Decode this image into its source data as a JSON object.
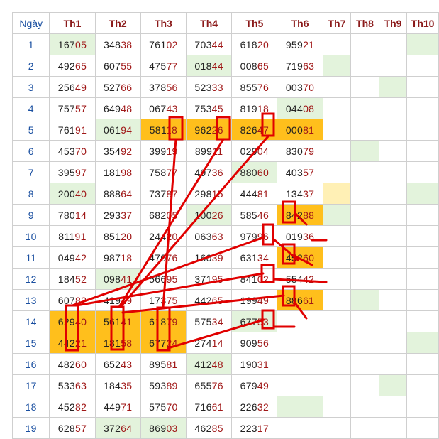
{
  "headers": [
    "Ngày",
    "Th1",
    "Th2",
    "Th3",
    "Th4",
    "Th5",
    "Th6",
    "Th7",
    "Th8",
    "Th9",
    "Th10"
  ],
  "rows": [
    {
      "day": "1",
      "cells": [
        {
          "head": "167",
          "tail": "05",
          "bg": "g"
        },
        {
          "head": "348",
          "tail": "38",
          "bg": ""
        },
        {
          "head": "761",
          "tail": "02",
          "bg": ""
        },
        {
          "head": "703",
          "tail": "44",
          "bg": ""
        },
        {
          "head": "618",
          "tail": "20",
          "bg": ""
        },
        {
          "head": "959",
          "tail": "21",
          "bg": ""
        },
        {
          "head": "",
          "tail": "",
          "bg": ""
        },
        {
          "head": "",
          "tail": "",
          "bg": ""
        },
        {
          "head": "",
          "tail": "",
          "bg": ""
        },
        {
          "head": "",
          "tail": "",
          "bg": "g"
        }
      ]
    },
    {
      "day": "2",
      "cells": [
        {
          "head": "492",
          "tail": "65",
          "bg": ""
        },
        {
          "head": "607",
          "tail": "55",
          "bg": ""
        },
        {
          "head": "475",
          "tail": "77",
          "bg": ""
        },
        {
          "head": "018",
          "tail": "44",
          "bg": "g"
        },
        {
          "head": "008",
          "tail": "65",
          "bg": ""
        },
        {
          "head": "719",
          "tail": "63",
          "bg": ""
        },
        {
          "head": "",
          "tail": "",
          "bg": "g"
        },
        {
          "head": "",
          "tail": "",
          "bg": ""
        },
        {
          "head": "",
          "tail": "",
          "bg": ""
        },
        {
          "head": "",
          "tail": "",
          "bg": ""
        }
      ]
    },
    {
      "day": "3",
      "cells": [
        {
          "head": "256",
          "tail": "49",
          "bg": ""
        },
        {
          "head": "527",
          "tail": "66",
          "bg": ""
        },
        {
          "head": "378",
          "tail": "56",
          "bg": ""
        },
        {
          "head": "523",
          "tail": "33",
          "bg": ""
        },
        {
          "head": "855",
          "tail": "76",
          "bg": ""
        },
        {
          "head": "003",
          "tail": "70",
          "bg": ""
        },
        {
          "head": "",
          "tail": "",
          "bg": ""
        },
        {
          "head": "",
          "tail": "",
          "bg": ""
        },
        {
          "head": "",
          "tail": "",
          "bg": "g"
        },
        {
          "head": "",
          "tail": "",
          "bg": ""
        }
      ]
    },
    {
      "day": "4",
      "cells": [
        {
          "head": "757",
          "tail": "57",
          "bg": ""
        },
        {
          "head": "649",
          "tail": "48",
          "bg": ""
        },
        {
          "head": "067",
          "tail": "43",
          "bg": ""
        },
        {
          "head": "753",
          "tail": "45",
          "bg": ""
        },
        {
          "head": "819",
          "tail": "18",
          "bg": ""
        },
        {
          "head": "044",
          "tail": "08",
          "bg": "g"
        },
        {
          "head": "",
          "tail": "",
          "bg": ""
        },
        {
          "head": "",
          "tail": "",
          "bg": ""
        },
        {
          "head": "",
          "tail": "",
          "bg": ""
        },
        {
          "head": "",
          "tail": "",
          "bg": ""
        }
      ]
    },
    {
      "day": "5",
      "cells": [
        {
          "head": "761",
          "tail": "91",
          "bg": ""
        },
        {
          "head": "061",
          "tail": "94",
          "bg": "g"
        },
        {
          "head": "581",
          "tail": "18",
          "bg": "o"
        },
        {
          "head": "962",
          "tail": "26",
          "bg": "o"
        },
        {
          "head": "826",
          "tail": "47",
          "bg": "o"
        },
        {
          "head": "000",
          "tail": "81",
          "bg": "o"
        },
        {
          "head": "",
          "tail": "",
          "bg": ""
        },
        {
          "head": "",
          "tail": "",
          "bg": ""
        },
        {
          "head": "",
          "tail": "",
          "bg": ""
        },
        {
          "head": "",
          "tail": "",
          "bg": ""
        }
      ]
    },
    {
      "day": "6",
      "cells": [
        {
          "head": "453",
          "tail": "70",
          "bg": ""
        },
        {
          "head": "354",
          "tail": "92",
          "bg": ""
        },
        {
          "head": "399",
          "tail": "19",
          "bg": ""
        },
        {
          "head": "899",
          "tail": "11",
          "bg": ""
        },
        {
          "head": "029",
          "tail": "04",
          "bg": ""
        },
        {
          "head": "830",
          "tail": "79",
          "bg": ""
        },
        {
          "head": "",
          "tail": "",
          "bg": ""
        },
        {
          "head": "",
          "tail": "",
          "bg": "g"
        },
        {
          "head": "",
          "tail": "",
          "bg": ""
        },
        {
          "head": "",
          "tail": "",
          "bg": ""
        }
      ]
    },
    {
      "day": "7",
      "cells": [
        {
          "head": "395",
          "tail": "97",
          "bg": ""
        },
        {
          "head": "181",
          "tail": "98",
          "bg": ""
        },
        {
          "head": "758",
          "tail": "77",
          "bg": ""
        },
        {
          "head": "497",
          "tail": "36",
          "bg": ""
        },
        {
          "head": "880",
          "tail": "60",
          "bg": "g"
        },
        {
          "head": "403",
          "tail": "57",
          "bg": ""
        },
        {
          "head": "",
          "tail": "",
          "bg": ""
        },
        {
          "head": "",
          "tail": "",
          "bg": ""
        },
        {
          "head": "",
          "tail": "",
          "bg": ""
        },
        {
          "head": "",
          "tail": "",
          "bg": ""
        }
      ]
    },
    {
      "day": "8",
      "cells": [
        {
          "head": "200",
          "tail": "40",
          "bg": "g"
        },
        {
          "head": "888",
          "tail": "64",
          "bg": ""
        },
        {
          "head": "737",
          "tail": "87",
          "bg": ""
        },
        {
          "head": "298",
          "tail": "15",
          "bg": ""
        },
        {
          "head": "444",
          "tail": "81",
          "bg": ""
        },
        {
          "head": "134",
          "tail": "37",
          "bg": ""
        },
        {
          "head": "",
          "tail": "",
          "bg": "y"
        },
        {
          "head": "",
          "tail": "",
          "bg": ""
        },
        {
          "head": "",
          "tail": "",
          "bg": ""
        },
        {
          "head": "",
          "tail": "",
          "bg": "g"
        }
      ]
    },
    {
      "day": "9",
      "cells": [
        {
          "head": "780",
          "tail": "14",
          "bg": ""
        },
        {
          "head": "293",
          "tail": "37",
          "bg": ""
        },
        {
          "head": "682",
          "tail": "05",
          "bg": ""
        },
        {
          "head": "100",
          "tail": "26",
          "bg": "g"
        },
        {
          "head": "585",
          "tail": "46",
          "bg": ""
        },
        {
          "head": "842",
          "tail": "88",
          "bg": "o"
        },
        {
          "head": "",
          "tail": "",
          "bg": "g"
        },
        {
          "head": "",
          "tail": "",
          "bg": ""
        },
        {
          "head": "",
          "tail": "",
          "bg": ""
        },
        {
          "head": "",
          "tail": "",
          "bg": ""
        }
      ]
    },
    {
      "day": "10",
      "cells": [
        {
          "head": "811",
          "tail": "91",
          "bg": ""
        },
        {
          "head": "851",
          "tail": "20",
          "bg": ""
        },
        {
          "head": "244",
          "tail": "20",
          "bg": ""
        },
        {
          "head": "063",
          "tail": "63",
          "bg": ""
        },
        {
          "head": "979",
          "tail": "96",
          "bg": ""
        },
        {
          "head": "019",
          "tail": "36",
          "bg": ""
        },
        {
          "head": "",
          "tail": "",
          "bg": ""
        },
        {
          "head": "",
          "tail": "",
          "bg": ""
        },
        {
          "head": "",
          "tail": "",
          "bg": ""
        },
        {
          "head": "",
          "tail": "",
          "bg": ""
        }
      ]
    },
    {
      "day": "11",
      "cells": [
        {
          "head": "049",
          "tail": "42",
          "bg": ""
        },
        {
          "head": "987",
          "tail": "18",
          "bg": ""
        },
        {
          "head": "470",
          "tail": "76",
          "bg": ""
        },
        {
          "head": "160",
          "tail": "39",
          "bg": ""
        },
        {
          "head": "631",
          "tail": "34",
          "bg": ""
        },
        {
          "head": "452",
          "tail": "60",
          "bg": "o"
        },
        {
          "head": "",
          "tail": "",
          "bg": ""
        },
        {
          "head": "",
          "tail": "",
          "bg": ""
        },
        {
          "head": "",
          "tail": "",
          "bg": ""
        },
        {
          "head": "",
          "tail": "",
          "bg": ""
        }
      ]
    },
    {
      "day": "12",
      "cells": [
        {
          "head": "184",
          "tail": "52",
          "bg": ""
        },
        {
          "head": "098",
          "tail": "41",
          "bg": "g"
        },
        {
          "head": "566",
          "tail": "95",
          "bg": ""
        },
        {
          "head": "371",
          "tail": "95",
          "bg": ""
        },
        {
          "head": "841",
          "tail": "02",
          "bg": ""
        },
        {
          "head": "554",
          "tail": "42",
          "bg": ""
        },
        {
          "head": "",
          "tail": "",
          "bg": ""
        },
        {
          "head": "",
          "tail": "",
          "bg": ""
        },
        {
          "head": "",
          "tail": "",
          "bg": ""
        },
        {
          "head": "",
          "tail": "",
          "bg": ""
        }
      ]
    },
    {
      "day": "13",
      "cells": [
        {
          "head": "607",
          "tail": "82",
          "bg": ""
        },
        {
          "head": "419",
          "tail": "19",
          "bg": ""
        },
        {
          "head": "173",
          "tail": "75",
          "bg": ""
        },
        {
          "head": "442",
          "tail": "65",
          "bg": ""
        },
        {
          "head": "199",
          "tail": "49",
          "bg": ""
        },
        {
          "head": "886",
          "tail": "61",
          "bg": "o"
        },
        {
          "head": "",
          "tail": "",
          "bg": ""
        },
        {
          "head": "",
          "tail": "",
          "bg": "g"
        },
        {
          "head": "",
          "tail": "",
          "bg": ""
        },
        {
          "head": "",
          "tail": "",
          "bg": ""
        }
      ]
    },
    {
      "day": "14",
      "cells": [
        {
          "head": "629",
          "tail": "40",
          "bg": "o"
        },
        {
          "head": "561",
          "tail": "41",
          "bg": "o"
        },
        {
          "head": "618",
          "tail": "79",
          "bg": "o"
        },
        {
          "head": "575",
          "tail": "34",
          "bg": ""
        },
        {
          "head": "677",
          "tail": "53",
          "bg": "g"
        },
        {
          "head": "",
          "tail": "",
          "bg": ""
        },
        {
          "head": "",
          "tail": "",
          "bg": ""
        },
        {
          "head": "",
          "tail": "",
          "bg": ""
        },
        {
          "head": "",
          "tail": "",
          "bg": ""
        },
        {
          "head": "",
          "tail": "",
          "bg": ""
        }
      ]
    },
    {
      "day": "15",
      "cells": [
        {
          "head": "442",
          "tail": "21",
          "bg": "o"
        },
        {
          "head": "181",
          "tail": "58",
          "bg": "o"
        },
        {
          "head": "677",
          "tail": "24",
          "bg": "o"
        },
        {
          "head": "274",
          "tail": "14",
          "bg": ""
        },
        {
          "head": "909",
          "tail": "56",
          "bg": ""
        },
        {
          "head": "",
          "tail": "",
          "bg": ""
        },
        {
          "head": "",
          "tail": "",
          "bg": ""
        },
        {
          "head": "",
          "tail": "",
          "bg": ""
        },
        {
          "head": "",
          "tail": "",
          "bg": ""
        },
        {
          "head": "",
          "tail": "",
          "bg": "g"
        }
      ]
    },
    {
      "day": "16",
      "cells": [
        {
          "head": "482",
          "tail": "60",
          "bg": ""
        },
        {
          "head": "652",
          "tail": "43",
          "bg": ""
        },
        {
          "head": "895",
          "tail": "81",
          "bg": ""
        },
        {
          "head": "412",
          "tail": "48",
          "bg": "g"
        },
        {
          "head": "190",
          "tail": "31",
          "bg": ""
        },
        {
          "head": "",
          "tail": "",
          "bg": ""
        },
        {
          "head": "",
          "tail": "",
          "bg": ""
        },
        {
          "head": "",
          "tail": "",
          "bg": ""
        },
        {
          "head": "",
          "tail": "",
          "bg": ""
        },
        {
          "head": "",
          "tail": "",
          "bg": ""
        }
      ]
    },
    {
      "day": "17",
      "cells": [
        {
          "head": "533",
          "tail": "63",
          "bg": ""
        },
        {
          "head": "184",
          "tail": "35",
          "bg": ""
        },
        {
          "head": "593",
          "tail": "89",
          "bg": ""
        },
        {
          "head": "655",
          "tail": "76",
          "bg": ""
        },
        {
          "head": "679",
          "tail": "49",
          "bg": ""
        },
        {
          "head": "",
          "tail": "",
          "bg": ""
        },
        {
          "head": "",
          "tail": "",
          "bg": ""
        },
        {
          "head": "",
          "tail": "",
          "bg": ""
        },
        {
          "head": "",
          "tail": "",
          "bg": "g"
        },
        {
          "head": "",
          "tail": "",
          "bg": ""
        }
      ]
    },
    {
      "day": "18",
      "cells": [
        {
          "head": "452",
          "tail": "82",
          "bg": ""
        },
        {
          "head": "449",
          "tail": "71",
          "bg": ""
        },
        {
          "head": "575",
          "tail": "70",
          "bg": ""
        },
        {
          "head": "716",
          "tail": "61",
          "bg": ""
        },
        {
          "head": "226",
          "tail": "32",
          "bg": ""
        },
        {
          "head": "",
          "tail": "",
          "bg": "g"
        },
        {
          "head": "",
          "tail": "",
          "bg": ""
        },
        {
          "head": "",
          "tail": "",
          "bg": ""
        },
        {
          "head": "",
          "tail": "",
          "bg": ""
        },
        {
          "head": "",
          "tail": "",
          "bg": ""
        }
      ]
    },
    {
      "day": "19",
      "cells": [
        {
          "head": "628",
          "tail": "57",
          "bg": ""
        },
        {
          "head": "372",
          "tail": "64",
          "bg": "g"
        },
        {
          "head": "869",
          "tail": "03",
          "bg": "g"
        },
        {
          "head": "462",
          "tail": "85",
          "bg": ""
        },
        {
          "head": "223",
          "tail": "17",
          "bg": ""
        },
        {
          "head": "",
          "tail": "",
          "bg": ""
        },
        {
          "head": "",
          "tail": "",
          "bg": ""
        },
        {
          "head": "",
          "tail": "",
          "bg": ""
        },
        {
          "head": "",
          "tail": "",
          "bg": ""
        },
        {
          "head": "",
          "tail": "",
          "bg": ""
        }
      ]
    }
  ],
  "colors": {
    "highlight_orange": "#ffbf1c",
    "highlight_green": "#e3f3dc",
    "highlight_yellow": "#fff0b5",
    "annotation_red": "#e00000"
  }
}
